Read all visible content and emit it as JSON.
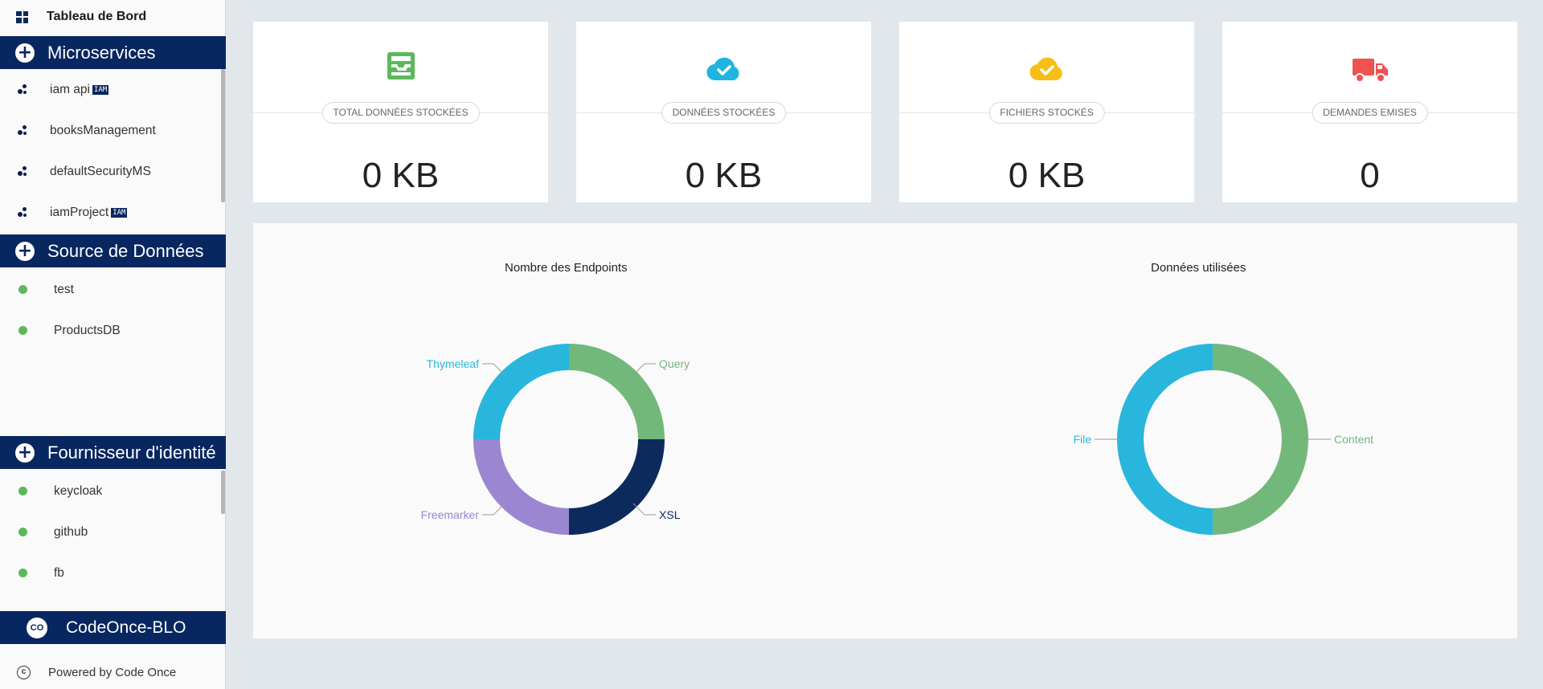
{
  "sidebar": {
    "dashboard_label": "Tableau de Bord",
    "microservices": {
      "title": "Microservices",
      "items": [
        {
          "label": "iam api",
          "badge": "IAM"
        },
        {
          "label": "booksManagement",
          "badge": ""
        },
        {
          "label": "defaultSecurityMS",
          "badge": ""
        },
        {
          "label": "iamProject",
          "badge": "IAM"
        }
      ]
    },
    "datasources": {
      "title": "Source de Données",
      "items": [
        {
          "label": "test"
        },
        {
          "label": "ProductsDB"
        }
      ]
    },
    "identity": {
      "title": "Fournisseur d'identité",
      "items": [
        {
          "label": "keycloak"
        },
        {
          "label": "github"
        },
        {
          "label": "fb"
        }
      ]
    },
    "brand": {
      "icon_text": "CO",
      "name": "CodeOnce-BLO"
    },
    "footer": {
      "text": "Powered by Code Once"
    }
  },
  "stats": [
    {
      "label": "TOTAL DONNÉES STOCKÉES",
      "value": "0 KB",
      "icon": "inbox-icon",
      "color": "#5cb85c"
    },
    {
      "label": "DONNÉES STOCKÉES",
      "value": "0 KB",
      "icon": "cloud-check-icon",
      "color": "#1fb5e0"
    },
    {
      "label": "FICHIERS STOCKÉS",
      "value": "0 KB",
      "icon": "cloud-check-icon",
      "color": "#f7be16"
    },
    {
      "label": "DEMANDES EMISES",
      "value": "0",
      "icon": "truck-icon",
      "color": "#f0524f"
    }
  ],
  "chart_data": [
    {
      "type": "pie",
      "title": "Nombre des Endpoints",
      "categories": [
        "Query",
        "XSL",
        "Freemarker",
        "Thymeleaf"
      ],
      "values": [
        25,
        25,
        25,
        25
      ],
      "colors": [
        "#72b87a",
        "#0d2a5c",
        "#9b86d2",
        "#29b6dc"
      ],
      "donut": true
    },
    {
      "type": "pie",
      "title": "Données utilisées",
      "categories": [
        "Content",
        "File"
      ],
      "values": [
        50,
        50
      ],
      "colors": [
        "#72b87a",
        "#29b6dc"
      ],
      "donut": true
    }
  ]
}
